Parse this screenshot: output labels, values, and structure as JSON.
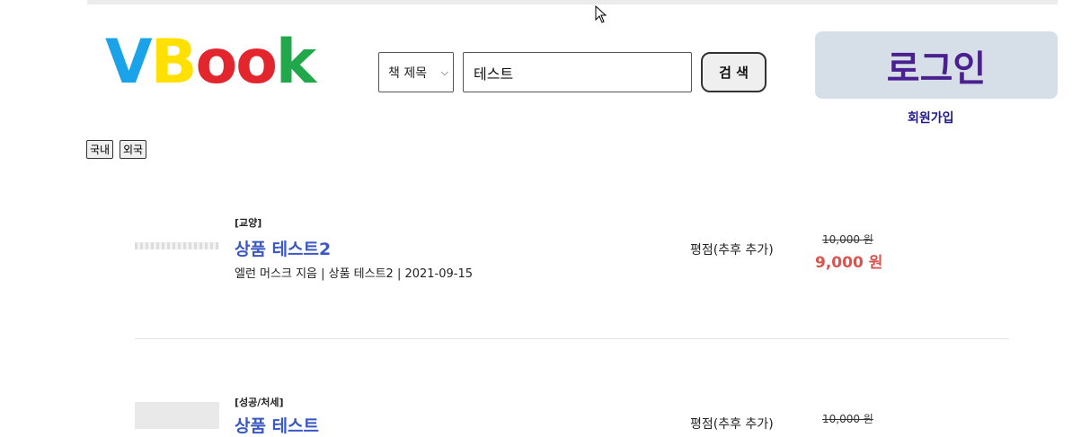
{
  "header": {
    "logo_letters": [
      {
        "char": "V",
        "color": "#1aa3e8"
      },
      {
        "char": "B",
        "color": "#ffe000"
      },
      {
        "char": "o",
        "color": "#e3262e"
      },
      {
        "char": "o",
        "color": "#e3262e"
      },
      {
        "char": "k",
        "color": "#21a84a"
      }
    ],
    "search": {
      "field_selected": "책 제목",
      "query": "테스트",
      "button_label": "검 색"
    },
    "login_label": "로그인",
    "signup_label": "회원가입"
  },
  "category_buttons": [
    "국내",
    "외국"
  ],
  "products": [
    {
      "category": "[교양]",
      "title": "상품 테스트2",
      "meta": "엘런 머스크 지음 | 상품 테스트2 | 2021-09-15",
      "rating": "평점(추후 추가)",
      "original_price": "10,000 원",
      "price": "9,000 원"
    },
    {
      "category": "[성공/처세]",
      "title": "상품 테스트",
      "rating": "평점(추후 추가)",
      "original_price": "10,000 원"
    }
  ],
  "colors": {
    "accent_title": "#3a57c4",
    "sale_price": "#d9534f",
    "login_bg": "#d6dfe7",
    "login_text": "#4a1f8f"
  }
}
